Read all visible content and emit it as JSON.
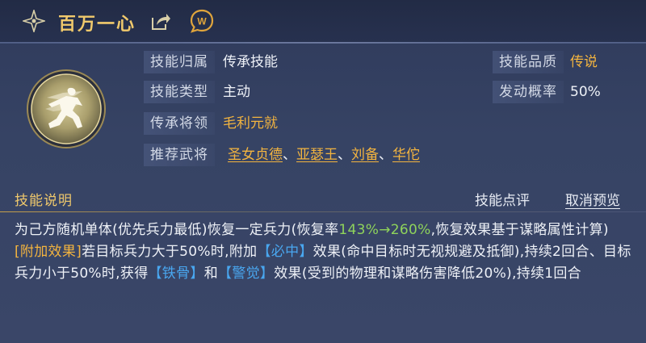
{
  "header": {
    "title": "百万一心",
    "icons": [
      "star-icon",
      "share-icon",
      "wiki-icon"
    ]
  },
  "skill": {
    "icon": "running-figure-icon",
    "info": {
      "attribution_label": "技能归属",
      "attribution_value": "传承技能",
      "type_label": "技能类型",
      "type_value": "主动",
      "inherit_label": "传承将领",
      "inherit_value": "毛利元就",
      "recommend_label": "推荐武将",
      "recommended": [
        "圣女贞德",
        "亚瑟王",
        "刘备",
        "华佗"
      ],
      "separator": "、",
      "quality_label": "技能品质",
      "quality_value": "传说",
      "rate_label": "发动概率",
      "rate_value": "50%"
    }
  },
  "description": {
    "section_title": "技能说明",
    "review_link": "技能点评",
    "cancel_link": "取消预览",
    "p1_a": "为己方随机单体(优先兵力最低)恢复一定兵力(恢复率",
    "p1_rate": "143%→260%",
    "p1_b": ",恢复效果基于谋略属性计算)",
    "p2_tag": "[附加效果]",
    "p2_a": "若目标兵力大于50%时,附加",
    "p2_bizhong": "【必中】",
    "p2_b": "效果(命中目标时无视规避及抵御),持续2回合、目标兵力小于50%时,获得",
    "p2_tiegu": "【铁骨】",
    "p2_and": "和",
    "p2_jingjue": "【警觉】",
    "p2_c": "效果(受到的物理和谋略伤害降低20%),持续1回合"
  },
  "colors": {
    "gold": "#f0c96c",
    "orange": "#f3b43f",
    "green": "#8fd35b",
    "blue": "#49a7f0",
    "background": "#364364"
  }
}
